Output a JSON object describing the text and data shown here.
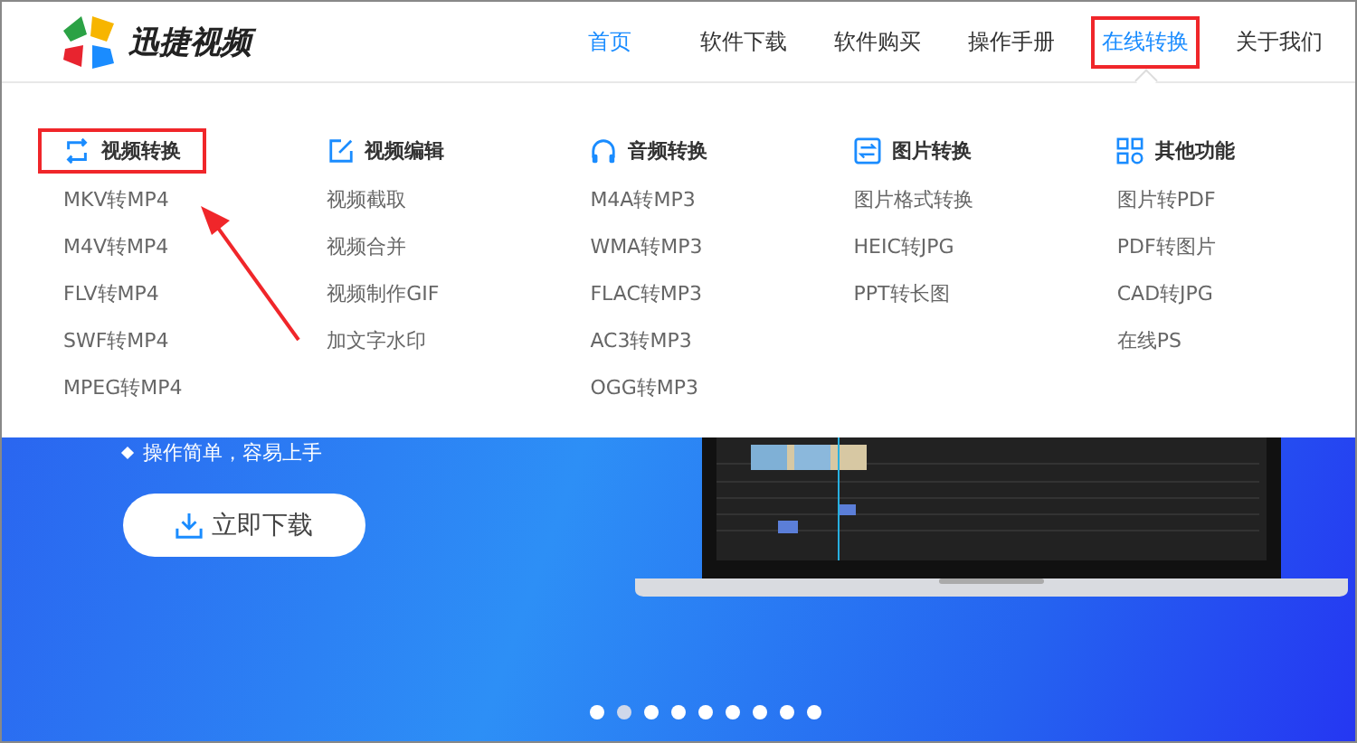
{
  "header": {
    "logo": {
      "name": "迅捷视频"
    },
    "nav": [
      {
        "label": "首页",
        "selected": true,
        "open": false,
        "highlighted": false
      },
      {
        "label": "软件下载",
        "selected": false,
        "open": false,
        "highlighted": false
      },
      {
        "label": "软件购买",
        "selected": false,
        "open": false,
        "highlighted": false
      },
      {
        "label": "操作手册",
        "selected": false,
        "open": false,
        "highlighted": false
      },
      {
        "label": "在线转换",
        "selected": true,
        "open": true,
        "highlighted": true
      },
      {
        "label": "关于我们",
        "selected": false,
        "open": false,
        "highlighted": false
      }
    ]
  },
  "dropdown": {
    "columns": [
      {
        "title": "视频转换",
        "highlighted": true,
        "items": [
          "MKV转MP4",
          "M4V转MP4",
          "FLV转MP4",
          "SWF转MP4",
          "MPEG转MP4"
        ]
      },
      {
        "title": "视频编辑",
        "highlighted": false,
        "items": [
          "视频截取",
          "视频合并",
          "视频制作GIF",
          "加文字水印"
        ]
      },
      {
        "title": "音频转换",
        "highlighted": false,
        "items": [
          "M4A转MP3",
          "WMA转MP3",
          "FLAC转MP3",
          "AC3转MP3",
          "OGG转MP3"
        ]
      },
      {
        "title": "图片转换",
        "highlighted": false,
        "items": [
          "图片格式转换",
          "HEIC转JPG",
          "PPT转长图"
        ]
      },
      {
        "title": "其他功能",
        "highlighted": false,
        "items": [
          "图片转PDF",
          "PDF转图片",
          "CAD转JPG",
          "在线PS"
        ]
      }
    ]
  },
  "hero": {
    "bullet": "操作简单，容易上手",
    "download_button": "立即下载",
    "carousel_dots": [
      {
        "selected": false
      },
      {
        "selected": true
      },
      {
        "selected": false
      },
      {
        "selected": false
      },
      {
        "selected": false
      },
      {
        "selected": false
      },
      {
        "selected": false
      },
      {
        "selected": false
      },
      {
        "selected": false
      }
    ]
  }
}
